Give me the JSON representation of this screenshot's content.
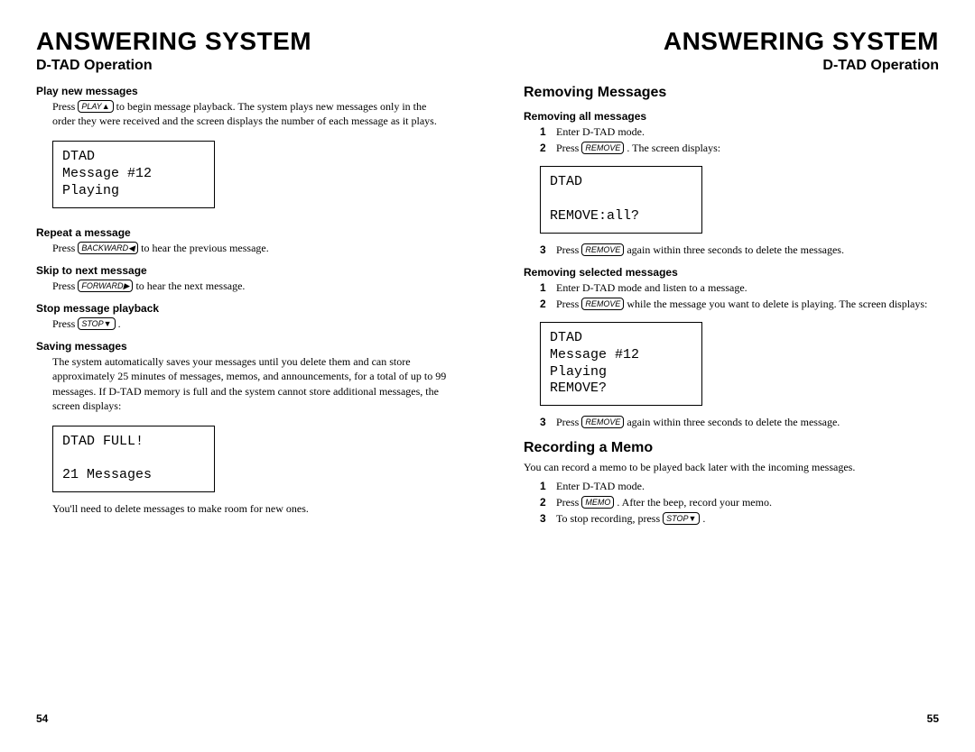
{
  "left": {
    "title": "ANSWERING SYSTEM",
    "subtitle": "D-TAD Operation",
    "play_new_heading": "Play new messages",
    "play_new_p1a": "Press ",
    "play_new_key": "PLAY▲",
    "play_new_p1b": " to begin message playback. The system plays new messages only in the order they were received and the screen displays the number of each message as it plays.",
    "lcd1": "DTAD\nMessage #12\nPlaying",
    "repeat_heading": "Repeat a message",
    "repeat_p_a": "Press ",
    "repeat_key": "BACKWARD◀",
    "repeat_p_b": " to hear the previous message.",
    "skip_heading": "Skip to next message",
    "skip_p_a": "Press ",
    "skip_key": "FORWARD▶",
    "skip_p_b": " to hear the next message.",
    "stop_heading": "Stop message playback",
    "stop_p_a": "Press ",
    "stop_key": "STOP▼",
    "stop_p_b": " .",
    "saving_heading": "Saving messages",
    "saving_p": "The system automatically saves your messages until you delete them and can store approximately 25 minutes of messages, memos, and announcements, for a total of up to 99 messages. If D-TAD memory is full and the system cannot store additional messages, the screen displays:",
    "lcd2": "DTAD FULL!\n\n21 Messages",
    "saving_after": "You'll need to delete messages to make room for new ones.",
    "page_num": "54"
  },
  "right": {
    "title": "ANSWERING SYSTEM",
    "subtitle": "D-TAD Operation",
    "removing_heading": "Removing Messages",
    "removing_all_sub": "Removing all messages",
    "ra_li1": "Enter D-TAD mode.",
    "ra_li2_a": "Press ",
    "ra_li2_key": "REMOVE",
    "ra_li2_b": " . The screen displays:",
    "lcd1": "DTAD\n\nREMOVE:all?",
    "ra_li3_a": "Press ",
    "ra_li3_key": "REMOVE",
    "ra_li3_b": " again within three seconds to delete the messages.",
    "removing_sel_sub": "Removing selected messages",
    "rs_li1": "Enter D-TAD mode and listen to a message.",
    "rs_li2_a": "Press ",
    "rs_li2_key": "REMOVE",
    "rs_li2_b": " while the message you want to delete is playing. The screen displays:",
    "lcd2": "DTAD\nMessage #12\nPlaying\nREMOVE?",
    "rs_li3_a": "Press ",
    "rs_li3_key": "REMOVE",
    "rs_li3_b": " again within three seconds to delete the message.",
    "recmemo_heading": "Recording a Memo",
    "recmemo_intro": "You can record a memo to be played back later with the incoming messages.",
    "rm_li1": "Enter D-TAD mode.",
    "rm_li2_a": "Press ",
    "rm_li2_key": "MEMO",
    "rm_li2_b": " . After the beep, record your memo.",
    "rm_li3_a": "To stop recording, press ",
    "rm_li3_key": "STOP▼",
    "rm_li3_b": " .",
    "page_num": "55"
  }
}
